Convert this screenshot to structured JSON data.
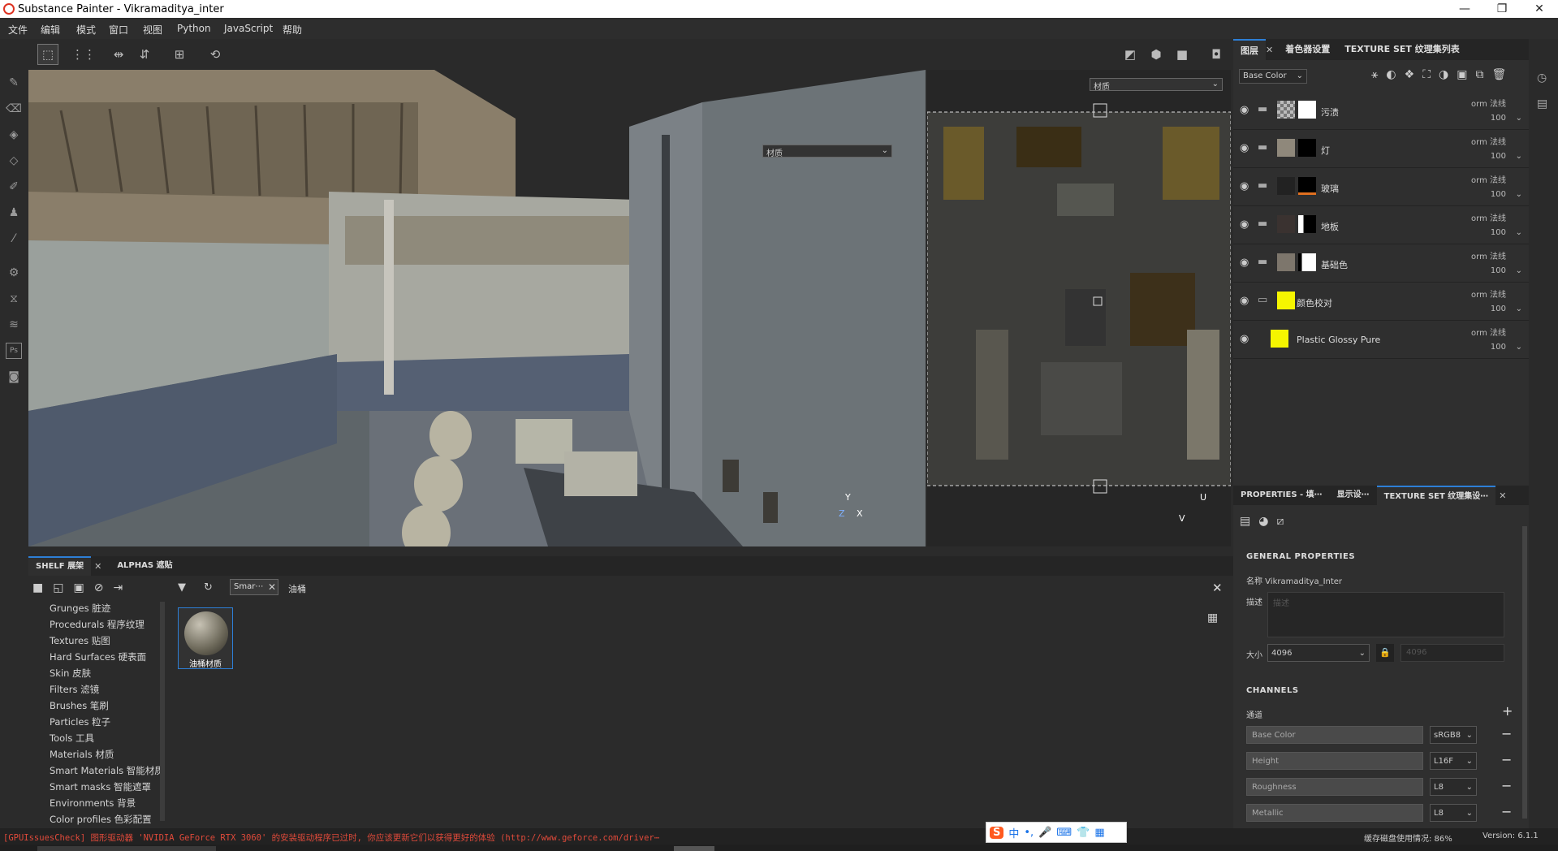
{
  "window": {
    "title": "Substance Painter - Vikramaditya_inter",
    "controls": {
      "min": "—",
      "max": "❐",
      "close": "✕"
    }
  },
  "menu": [
    "文件",
    "编辑",
    "模式",
    "窗口",
    "视图",
    "Python",
    "JavaScript",
    "帮助"
  ],
  "viewport": {
    "left_select": "材质",
    "right_select": "材质",
    "axes3d": {
      "y": "Y",
      "x": "X",
      "z": "Z"
    },
    "axes2d": {
      "u": "U",
      "v": "V"
    }
  },
  "layers_panel": {
    "tabs": [
      "图层",
      "着色器设置",
      "TEXTURE SET 纹理集列表"
    ],
    "channel_select": "Base Color",
    "layers": [
      {
        "name": "污渍",
        "mode": "orm 法线",
        "opacity": "100"
      },
      {
        "name": "灯",
        "mode": "orm 法线",
        "opacity": "100"
      },
      {
        "name": "玻璃",
        "mode": "orm 法线",
        "opacity": "100"
      },
      {
        "name": "地板",
        "mode": "orm 法线",
        "opacity": "100"
      },
      {
        "name": "基础色",
        "mode": "orm 法线",
        "opacity": "100"
      },
      {
        "name": "颜色校对",
        "mode": "orm 法线",
        "opacity": "100"
      },
      {
        "name": "Plastic Glossy Pure",
        "mode": "orm 法线",
        "opacity": "100"
      }
    ]
  },
  "properties_panel": {
    "tabs": [
      "PROPERTIES - 填⋯",
      "显示设⋯",
      "TEXTURE SET 纹理集设⋯"
    ],
    "general_title": "GENERAL PROPERTIES",
    "name_line": "名称 Vikramaditya_Inter",
    "desc_label": "描述",
    "desc_placeholder": "描述",
    "size_label": "大小",
    "size_value": "4096",
    "size_value2": "4096",
    "channels_title": "CHANNELS",
    "channels_label": "通道",
    "add": "+",
    "channels": [
      {
        "name": "Base Color",
        "format": "sRGB8"
      },
      {
        "name": "Height",
        "format": "L16F"
      },
      {
        "name": "Roughness",
        "format": "L8"
      },
      {
        "name": "Metallic",
        "format": "L8"
      }
    ]
  },
  "shelf": {
    "tabs": [
      "SHELF 展架",
      "ALPHAS 遮贴"
    ],
    "categories": [
      "Grunges 脏迹",
      "Procedurals 程序纹理",
      "Textures 贴图",
      "Hard Surfaces 硬表面",
      "Skin 皮肤",
      "Filters 滤镜",
      "Brushes 笔刷",
      "Particles 粒子",
      "Tools 工具",
      "Materials 材质",
      "Smart Materials 智能材质",
      "Smart masks 智能遮罩",
      "Environments 背景",
      "Color profiles 色彩配置"
    ],
    "filter_chip": "Smar⋯",
    "search_text": "油桶",
    "results": [
      {
        "label": "油桶材质"
      }
    ]
  },
  "status": {
    "error": "[GPUIssuesCheck] 图形驱动器 'NVIDIA GeForce RTX 3060' 的安装驱动程序已过时, 你应该更新它们以获得更好的体验 (http://www.geforce.com/driver⋯",
    "cache": "缓存磁盘使用情况: 86%",
    "version": "Version: 6.1.1"
  },
  "ime": {
    "logo": "S",
    "lang": "中"
  },
  "colors": {
    "accent": "#2d7fd6",
    "error": "#e04a3a",
    "yellow_swatch": "#f5f500"
  }
}
